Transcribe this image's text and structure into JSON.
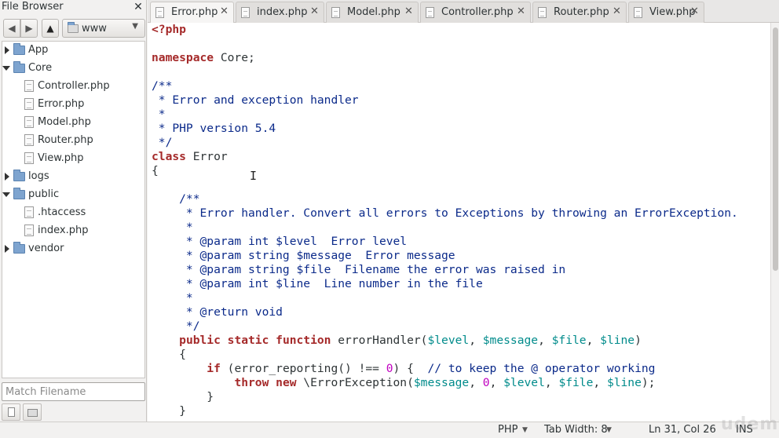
{
  "side_panel": {
    "title": "File Browser",
    "close_symbol": "✕",
    "location": "www",
    "filter_placeholder": "Match Filename",
    "icons": {
      "back": "arrow-left-icon",
      "forward": "arrow-right-icon",
      "up": "arrow-up-icon",
      "close": "close-icon"
    },
    "tree": [
      {
        "label": "App",
        "kind": "folder",
        "expanded": false,
        "depth": 0
      },
      {
        "label": "Core",
        "kind": "folder",
        "expanded": true,
        "depth": 0
      },
      {
        "label": "Controller.php",
        "kind": "file",
        "depth": 1
      },
      {
        "label": "Error.php",
        "kind": "file",
        "depth": 1
      },
      {
        "label": "Model.php",
        "kind": "file",
        "depth": 1
      },
      {
        "label": "Router.php",
        "kind": "file",
        "depth": 1
      },
      {
        "label": "View.php",
        "kind": "file",
        "depth": 1
      },
      {
        "label": "logs",
        "kind": "folder",
        "expanded": false,
        "depth": 0
      },
      {
        "label": "public",
        "kind": "folder",
        "expanded": true,
        "depth": 0
      },
      {
        "label": ".htaccess",
        "kind": "file",
        "depth": 1
      },
      {
        "label": "index.php",
        "kind": "file",
        "depth": 1
      },
      {
        "label": "vendor",
        "kind": "folder",
        "expanded": false,
        "depth": 0
      }
    ]
  },
  "tabs": [
    {
      "label": "Error.php",
      "active": true
    },
    {
      "label": "index.php",
      "active": false
    },
    {
      "label": "Model.php",
      "active": false
    },
    {
      "label": "Controller.php",
      "active": false
    },
    {
      "label": "Router.php",
      "active": false
    },
    {
      "label": "View.php",
      "active": false
    }
  ],
  "tab_close_symbol": "✕",
  "editor": {
    "lines": [
      [
        {
          "t": "<?php",
          "c": "kw"
        }
      ],
      [],
      [
        {
          "t": "namespace",
          "c": "kw"
        },
        {
          "t": " Core;",
          "c": "plain"
        }
      ],
      [],
      [
        {
          "t": "/**",
          "c": "cm"
        }
      ],
      [
        {
          "t": " * Error and exception handler",
          "c": "cm"
        }
      ],
      [
        {
          "t": " *",
          "c": "cm"
        }
      ],
      [
        {
          "t": " * PHP version 5.4",
          "c": "cm"
        }
      ],
      [
        {
          "t": " */",
          "c": "cm"
        }
      ],
      [
        {
          "t": "class",
          "c": "kw"
        },
        {
          "t": " Error",
          "c": "plain"
        }
      ],
      [
        {
          "t": "{",
          "c": "plain"
        }
      ],
      [],
      [
        {
          "t": "    /**",
          "c": "cm"
        }
      ],
      [
        {
          "t": "     * Error handler. Convert all errors to Exceptions by throwing an ErrorException.",
          "c": "cm"
        }
      ],
      [
        {
          "t": "     *",
          "c": "cm"
        }
      ],
      [
        {
          "t": "     * @param int $level  Error level",
          "c": "cm"
        }
      ],
      [
        {
          "t": "     * @param string $message  Error message",
          "c": "cm"
        }
      ],
      [
        {
          "t": "     * @param string $file  Filename the error was raised in",
          "c": "cm"
        }
      ],
      [
        {
          "t": "     * @param int $line  Line number in the file",
          "c": "cm"
        }
      ],
      [
        {
          "t": "     *",
          "c": "cm"
        }
      ],
      [
        {
          "t": "     * @return void",
          "c": "cm"
        }
      ],
      [
        {
          "t": "     */",
          "c": "cm"
        }
      ],
      [
        {
          "t": "    ",
          "c": "plain"
        },
        {
          "t": "public static function",
          "c": "kw"
        },
        {
          "t": " errorHandler(",
          "c": "plain"
        },
        {
          "t": "$level",
          "c": "var"
        },
        {
          "t": ", ",
          "c": "plain"
        },
        {
          "t": "$message",
          "c": "var"
        },
        {
          "t": ", ",
          "c": "plain"
        },
        {
          "t": "$file",
          "c": "var"
        },
        {
          "t": ", ",
          "c": "plain"
        },
        {
          "t": "$line",
          "c": "var"
        },
        {
          "t": ")",
          "c": "plain"
        }
      ],
      [
        {
          "t": "    {",
          "c": "plain"
        }
      ],
      [
        {
          "t": "        ",
          "c": "plain"
        },
        {
          "t": "if",
          "c": "kw"
        },
        {
          "t": " (error_reporting() !== ",
          "c": "plain"
        },
        {
          "t": "0",
          "c": "num"
        },
        {
          "t": ") {  ",
          "c": "plain"
        },
        {
          "t": "// to keep the @ operator working",
          "c": "cm"
        }
      ],
      [
        {
          "t": "            ",
          "c": "plain"
        },
        {
          "t": "throw new",
          "c": "kw"
        },
        {
          "t": " \\ErrorException(",
          "c": "plain"
        },
        {
          "t": "$message",
          "c": "var"
        },
        {
          "t": ", ",
          "c": "plain"
        },
        {
          "t": "0",
          "c": "num"
        },
        {
          "t": ", ",
          "c": "plain"
        },
        {
          "t": "$level",
          "c": "var"
        },
        {
          "t": ", ",
          "c": "plain"
        },
        {
          "t": "$file",
          "c": "var"
        },
        {
          "t": ", ",
          "c": "plain"
        },
        {
          "t": "$line",
          "c": "var"
        },
        {
          "t": ");",
          "c": "plain"
        }
      ],
      [
        {
          "t": "        }",
          "c": "plain"
        }
      ],
      [
        {
          "t": "    }",
          "c": "plain"
        }
      ]
    ]
  },
  "status": {
    "language": "PHP",
    "tab_width": "Tab Width: 8",
    "position": "Ln 31, Col 26",
    "mode": "INS",
    "dropdown_symbol": "▼"
  },
  "watermark": "udemy"
}
